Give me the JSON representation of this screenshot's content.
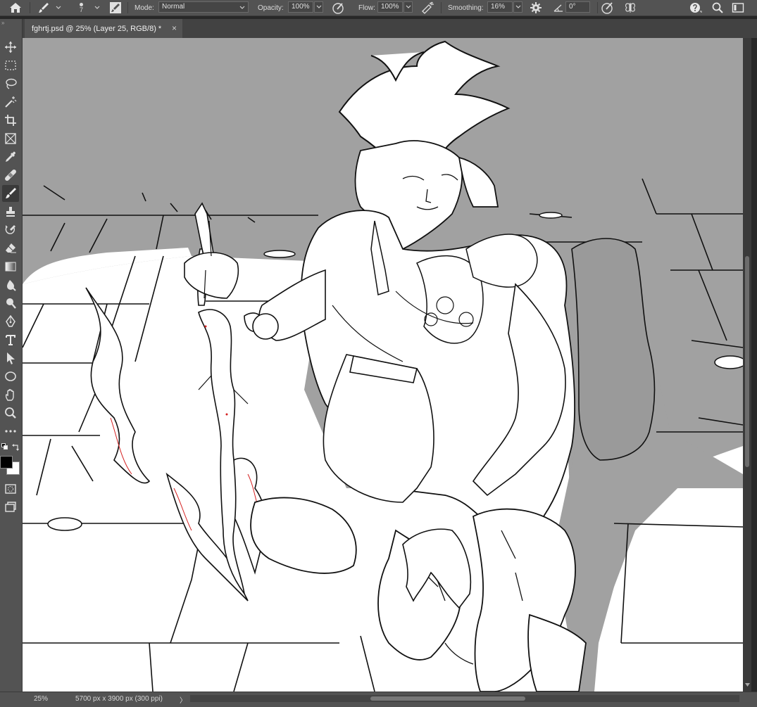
{
  "options_bar": {
    "brush_size": "7",
    "mode_label": "Mode:",
    "mode_value": "Normal",
    "opacity_label": "Opacity:",
    "opacity_value": "100%",
    "flow_label": "Flow:",
    "flow_value": "100%",
    "smoothing_label": "Smoothing:",
    "smoothing_value": "16%",
    "angle_value": "0°"
  },
  "document_tab": {
    "title": "fghrtj.psd @ 25% (Layer 25, RGB/8) *",
    "close": "×"
  },
  "status_bar": {
    "zoom": "25%",
    "doc_info": "5700 px x 3900 px (300 ppi)",
    "arrow": "〉"
  },
  "colors": {
    "foreground": "#000000",
    "background": "#ffffff",
    "ui_panel": "#535353",
    "canvas_gray": "#a1a1a1"
  },
  "icons": [
    "home-icon",
    "brush-icon",
    "brush-settings-icon",
    "airbrush-icon",
    "pressure-size-icon",
    "gear-icon",
    "angle-icon",
    "symmetry-icon",
    "help-icon",
    "search-icon",
    "workspace-icon",
    "move-icon",
    "marquee-icon",
    "lasso-icon",
    "magic-wand-icon",
    "crop-icon",
    "frame-icon",
    "eyedropper-icon",
    "healing-icon",
    "brush-tool-icon",
    "stamp-icon",
    "history-brush-icon",
    "eraser-icon",
    "gradient-icon",
    "blur-icon",
    "dodge-icon",
    "pen-icon",
    "type-icon",
    "path-select-icon",
    "ellipse-icon",
    "hand-icon",
    "zoom-icon",
    "more-icon",
    "quick-mask-icon",
    "screen-mode-icon"
  ]
}
